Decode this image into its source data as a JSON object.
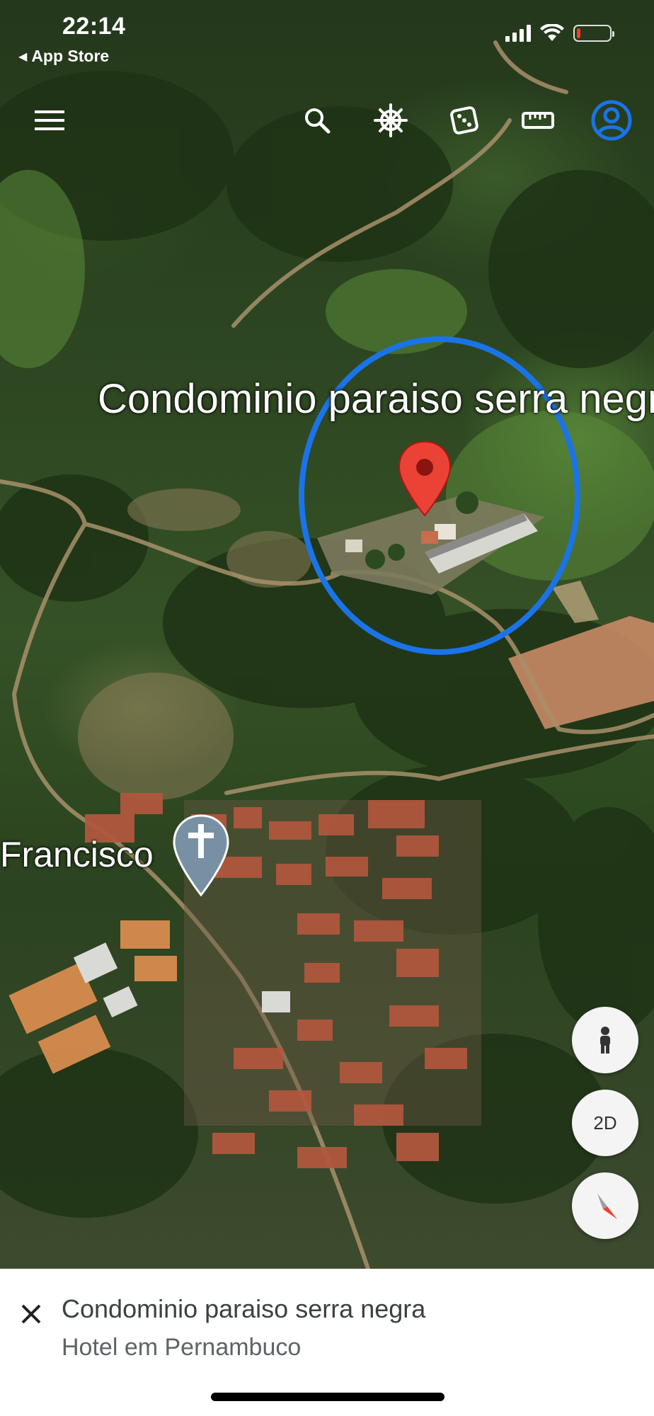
{
  "status_bar": {
    "time": "22:14",
    "back_app": "App Store",
    "back_arrow": "◀",
    "icons": [
      "signal-icon",
      "wifi-icon",
      "battery-icon"
    ],
    "battery_level": 0.12,
    "battery_color": "#ff3b30"
  },
  "toolbar": {
    "buttons": [
      "menu-icon",
      "search-icon",
      "voyager-wheel-icon",
      "dice-icon",
      "ruler-icon",
      "account-icon"
    ],
    "account_color": "#1a73e8"
  },
  "map": {
    "primary_label": "Condominio paraiso serra negra",
    "secondary_label": "Francisco",
    "highlight_color": "#1a73e8",
    "pin_color": "#ea4335",
    "church_pin_color": "#7890a4"
  },
  "controls": {
    "pegman": "person-icon",
    "view_toggle": "2D",
    "compass": "compass-icon"
  },
  "sheet": {
    "title": "Condominio paraiso serra negra",
    "subtitle": "Hotel em Pernambuco"
  }
}
